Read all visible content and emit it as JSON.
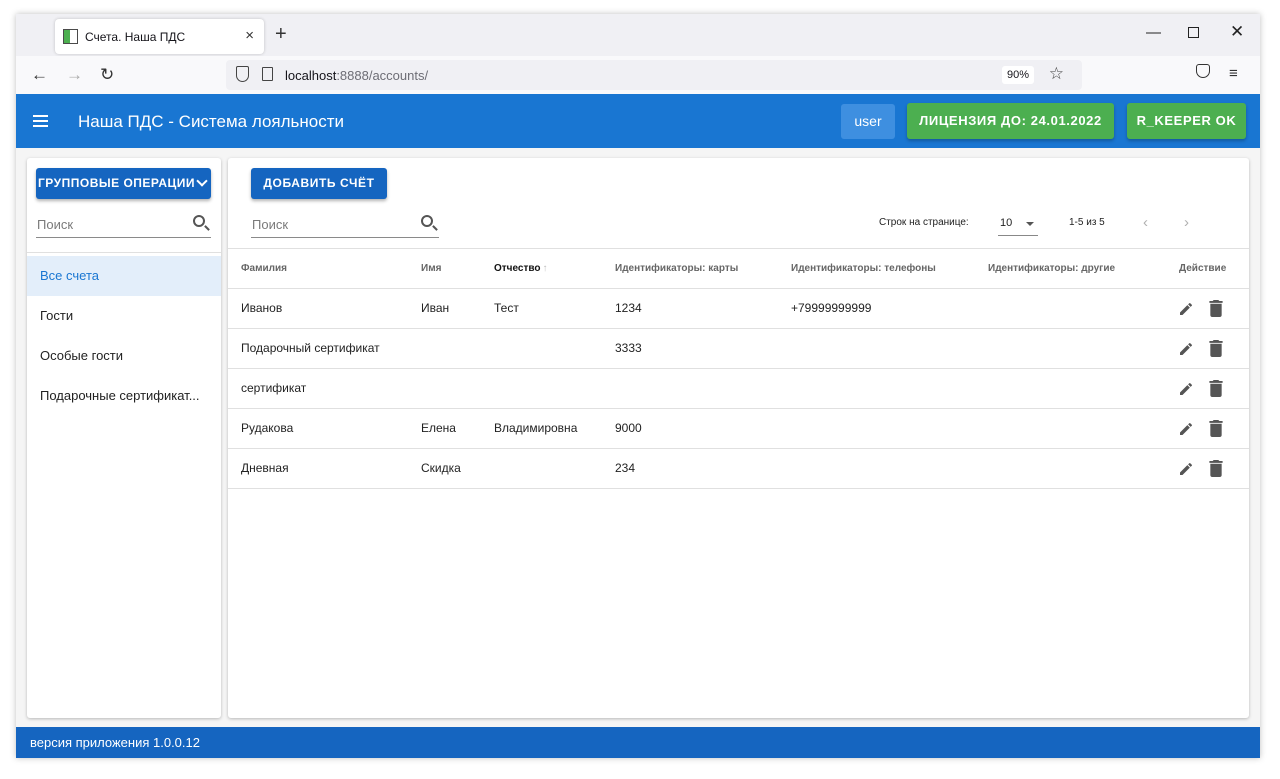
{
  "browser": {
    "tab_title": "Счета. Наша ПДС",
    "tab_close": "×",
    "new_tab": "+",
    "url_host": "localhost",
    "url_rest": ":8888/accounts/",
    "zoom": "90%"
  },
  "app": {
    "title": "Наша ПДС - Система лояльности",
    "user_label": "user",
    "license_label": "ЛИЦЕНЗИЯ ДО: 24.01.2022",
    "rkeeper_label": "R_KEEPER OK"
  },
  "sidebar": {
    "group_ops_label": "ГРУППОВЫЕ ОПЕРАЦИИ",
    "search_placeholder": "Поиск",
    "items": [
      {
        "label": "Все счета",
        "active": true
      },
      {
        "label": "Гости"
      },
      {
        "label": "Особые гости"
      },
      {
        "label": "Подарочные сертификат..."
      }
    ]
  },
  "main": {
    "add_label": "ДОБАВИТЬ СЧЁТ",
    "search_placeholder": "Поиск",
    "rows_per_page_label": "Строк на странице:",
    "rows_per_page_value": "10",
    "range_label": "1-5 из 5",
    "columns": [
      "Фамилия",
      "Имя",
      "Отчество",
      "Идентификаторы: карты",
      "Идентификаторы: телефоны",
      "Идентификаторы: другие",
      "Действие"
    ],
    "sort_arrow": "↑",
    "rows": [
      {
        "last": "Иванов",
        "first": "Иван",
        "middle": "Тест",
        "cards": "1234",
        "phones": "+79999999999",
        "other": ""
      },
      {
        "last": "Подарочный сертификат",
        "first": "",
        "middle": "",
        "cards": "3333",
        "phones": "",
        "other": ""
      },
      {
        "last": "сертификат",
        "first": "",
        "middle": "",
        "cards": "",
        "phones": "",
        "other": ""
      },
      {
        "last": "Рудакова",
        "first": "Елена",
        "middle": "Владимировна",
        "cards": "9000",
        "phones": "",
        "other": ""
      },
      {
        "last": "Дневная",
        "first": "Скидка",
        "middle": "",
        "cards": "234",
        "phones": "",
        "other": ""
      }
    ]
  },
  "footer": {
    "version": "версия приложения 1.0.0.12"
  },
  "colors": {
    "app_bar": "#1976d2",
    "primary_button": "#1565c0",
    "success": "#4caf50"
  }
}
